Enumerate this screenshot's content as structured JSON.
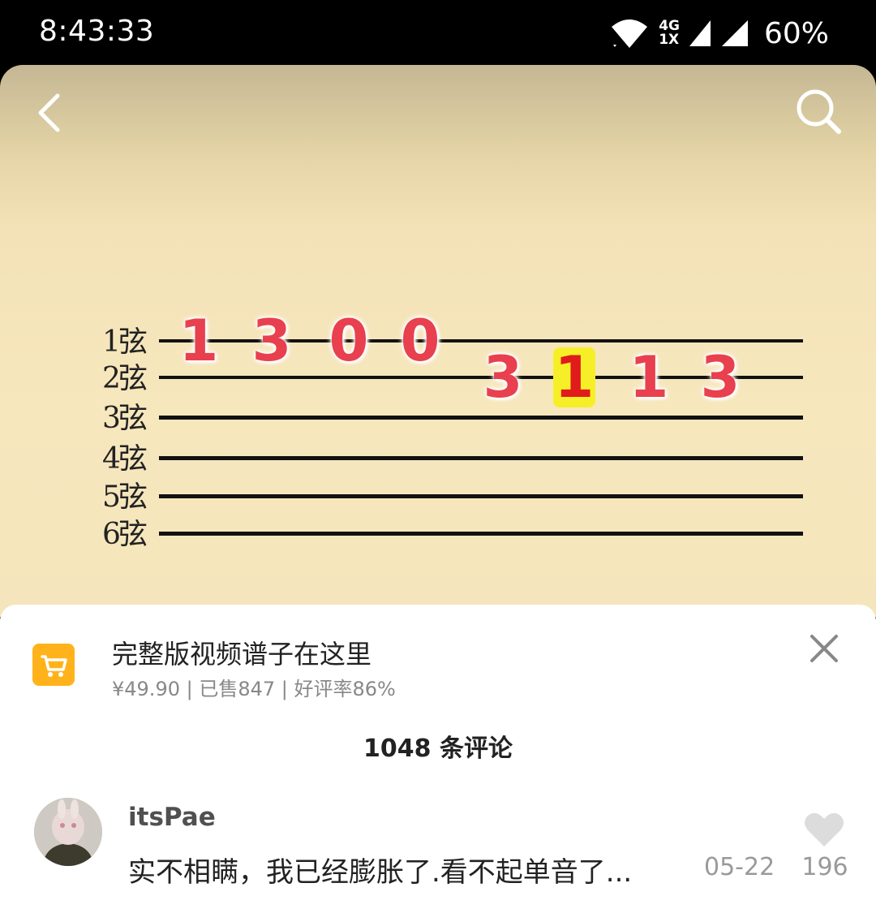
{
  "status_bar": {
    "time": "8:43:33",
    "network_top": "4G",
    "network_bottom": "1X",
    "battery": "60%"
  },
  "video": {
    "strings": [
      "1弦",
      "2弦",
      "3弦",
      "4弦",
      "5弦",
      "6弦"
    ],
    "notes": [
      {
        "string": 1,
        "fret": "1",
        "highlighted": false
      },
      {
        "string": 1,
        "fret": "3",
        "highlighted": false
      },
      {
        "string": 1,
        "fret": "0",
        "highlighted": false
      },
      {
        "string": 1,
        "fret": "0",
        "highlighted": false
      },
      {
        "string": 2,
        "fret": "3",
        "highlighted": false
      },
      {
        "string": 2,
        "fret": "1",
        "highlighted": true
      },
      {
        "string": 2,
        "fret": "1",
        "highlighted": false
      },
      {
        "string": 2,
        "fret": "3",
        "highlighted": false
      }
    ],
    "colors": {
      "note": "#e8404e",
      "highlight_bg": "#f6ef28",
      "highlight_text": "#e01b1b"
    }
  },
  "product": {
    "title": "完整版视频谱子在这里",
    "meta": "¥49.90 | 已售847 | 好评率86%",
    "accent": "#ffb21a"
  },
  "comments": {
    "count_label": "1048 条评论",
    "items": [
      {
        "username": "itsPae",
        "text": "实不相瞒，我已经膨胀了.看不起单音了...",
        "date": "05-22",
        "likes": "196"
      }
    ]
  }
}
